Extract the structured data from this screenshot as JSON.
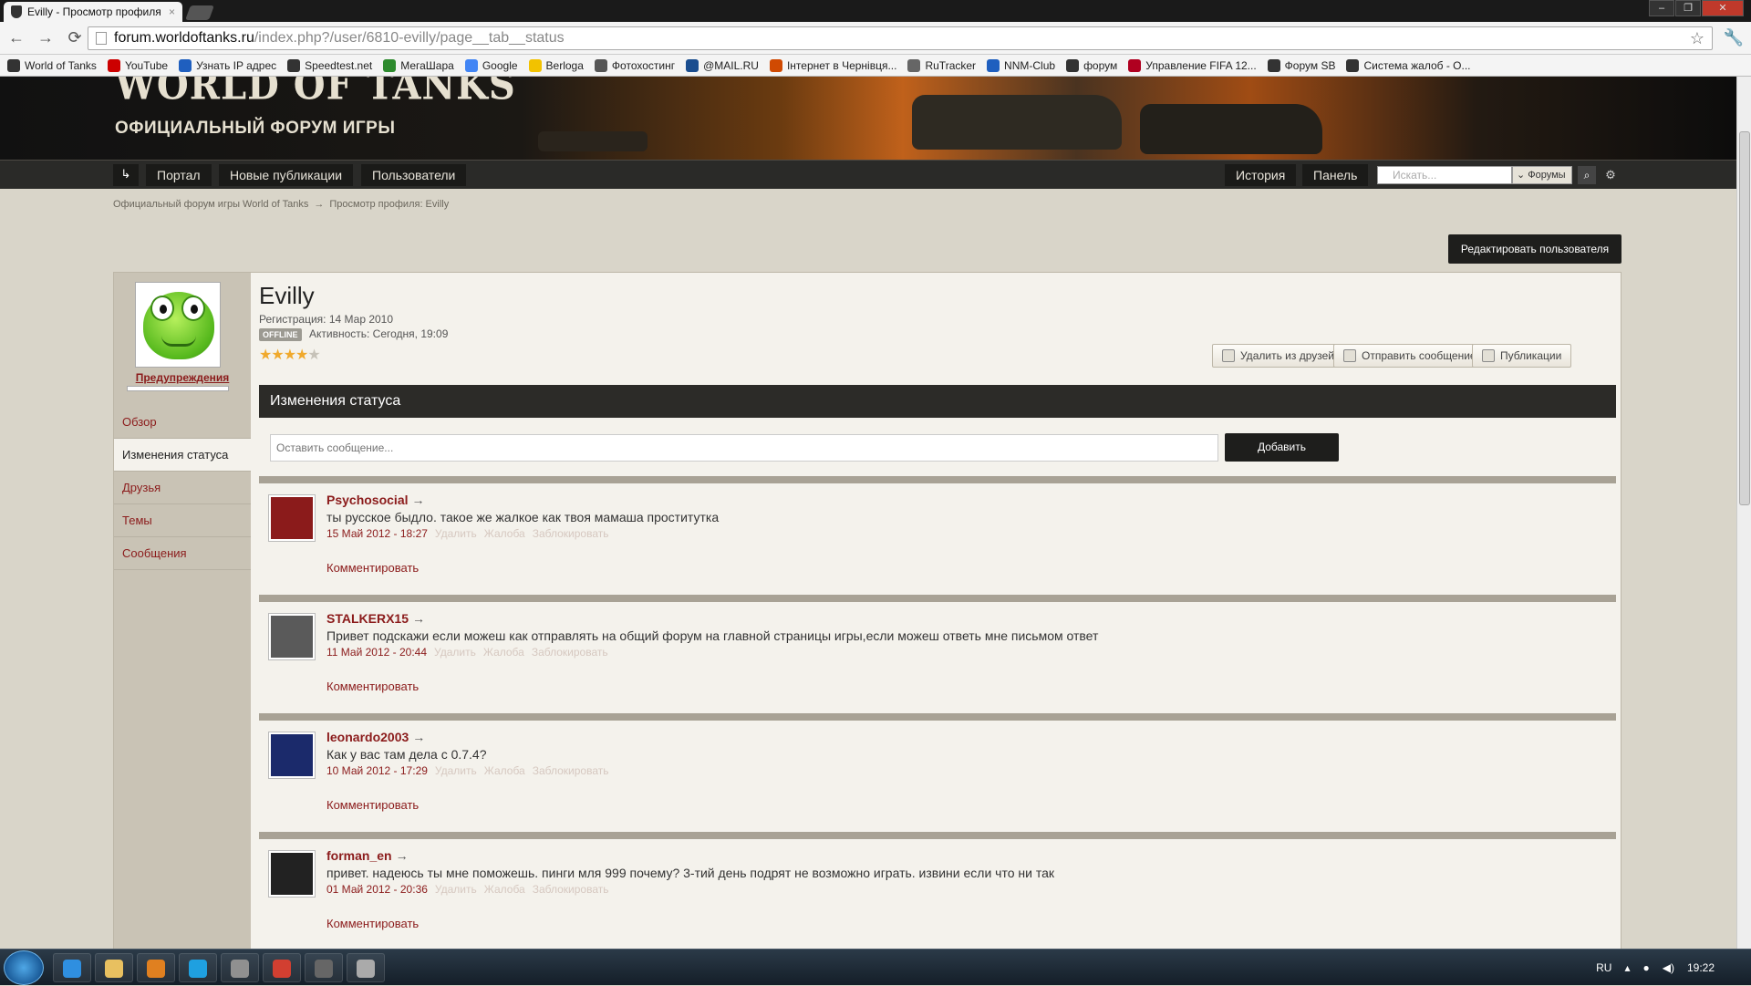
{
  "browser": {
    "tab_title": "Evilly - Просмотр профиля",
    "tab_close": "×",
    "url_domain": "forum.worldoftanks.ru",
    "url_path": "/index.php?/user/6810-evilly/page__tab__status",
    "back": "←",
    "forward": "→",
    "reload": "⟳",
    "star": "☆",
    "menu": "🔧",
    "window_controls": [
      "–",
      "❐",
      "✕"
    ]
  },
  "bookmarks": [
    {
      "label": "World of Tanks",
      "color": "#333333"
    },
    {
      "label": "YouTube",
      "color": "#cc0000"
    },
    {
      "label": "Узнать IP адрес",
      "color": "#1f5fbf"
    },
    {
      "label": "Speedtest.net",
      "color": "#333333"
    },
    {
      "label": "МегаШара",
      "color": "#2e8b2e"
    },
    {
      "label": "Google",
      "color": "#4285f4"
    },
    {
      "label": "Berloga",
      "color": "#f2c200"
    },
    {
      "label": "Фотохостинг",
      "color": "#555555"
    },
    {
      "label": "@MAIL.RU",
      "color": "#1a4d8f"
    },
    {
      "label": "Інтернет в Чернівця...",
      "color": "#d04a02"
    },
    {
      "label": "RuTracker",
      "color": "#666666"
    },
    {
      "label": "NNM-Club",
      "color": "#1f5fbf"
    },
    {
      "label": "форум",
      "color": "#333333"
    },
    {
      "label": "Управление FIFA 12...",
      "color": "#b00020"
    },
    {
      "label": "Форум SB",
      "color": "#333333"
    },
    {
      "label": "Система жалоб - О...",
      "color": "#333333"
    }
  ],
  "banner": {
    "logo": "WORLD OF TANKS",
    "subtitle": "ОФИЦИАЛЬНЫЙ ФОРУМ ИГРЫ"
  },
  "nav": {
    "home": "↳",
    "items": [
      "Портал",
      "Новые публикации",
      "Пользователи"
    ],
    "right_items": [
      "История",
      "Панель"
    ],
    "search_placeholder": "Искать...",
    "search_scope": "⌄ Форумы",
    "search_btn": "⌕",
    "settings": "⚙"
  },
  "breadcrumb": {
    "root": "Официальный форум игры World of Tanks",
    "sep": "→",
    "current": "Просмотр профиля: Evilly"
  },
  "edit_user_button": "Редактировать пользователя",
  "profile": {
    "username": "Evilly",
    "registration_label": "Регистрация:",
    "registration_date": "14 Мар 2010",
    "status_badge": "OFFLINE",
    "activity": "Активность: Сегодня, 19:09",
    "warnings_label": "Предупреждения",
    "rating_stars": 4,
    "rating_max": 5,
    "actions": [
      "Удалить из друзей",
      "Отправить сообщение",
      "Публикации"
    ]
  },
  "sidebar_tabs": [
    {
      "label": "Обзор",
      "active": false
    },
    {
      "label": "Изменения статуса",
      "active": true
    },
    {
      "label": "Друзья",
      "active": false
    },
    {
      "label": "Темы",
      "active": false
    },
    {
      "label": "Сообщения",
      "active": false
    }
  ],
  "status_section": {
    "title": "Изменения статуса",
    "input_placeholder": "Оставить сообщение...",
    "add_button": "Добавить",
    "arrow": "→",
    "link_delete": "Удалить",
    "link_report": "Жалоба",
    "link_block": "Заблокировать",
    "link_comment": "Комментировать",
    "items": [
      {
        "author": "Psychosocial",
        "text": "ты русское быдло. такое же жалкое как твоя мамаша проститутка",
        "date": "15 Май 2012 - 18:27",
        "avatar_color": "#8b1b1b"
      },
      {
        "author": "STALKERX15",
        "text": "Привет подскажи если можеш как отправлять на общий форум на главной страницы игры,если можеш ответь мне письмом ответ",
        "date": "11 Май 2012 - 20:44",
        "avatar_color": "#5a5a5a"
      },
      {
        "author": "leonardo2003",
        "text": "Как у вас там дела с 0.7.4?",
        "date": "10 Май 2012 - 17:29",
        "avatar_color": "#1b2a6b"
      },
      {
        "author": "forman_en",
        "text": "привет. надеюсь ты мне поможешь. пинги мля 999 почему? 3-тий день подрят не возможно играть. извини если что ни так",
        "date": "01 Май 2012 - 20:36",
        "avatar_color": "#222222"
      }
    ]
  },
  "taskbar": {
    "apps": [
      {
        "name": "ie",
        "color": "#2f8fe0"
      },
      {
        "name": "explorer",
        "color": "#e8c060"
      },
      {
        "name": "media-player",
        "color": "#e08020"
      },
      {
        "name": "skype",
        "color": "#1fa0e0"
      },
      {
        "name": "app",
        "color": "#909090"
      },
      {
        "name": "chrome",
        "color": "#d23f31"
      },
      {
        "name": "world-of-tanks",
        "color": "#666666"
      },
      {
        "name": "app2",
        "color": "#aaaaaa"
      }
    ],
    "lang": "RU",
    "tray_arrow": "▴",
    "clock": "19:22"
  }
}
